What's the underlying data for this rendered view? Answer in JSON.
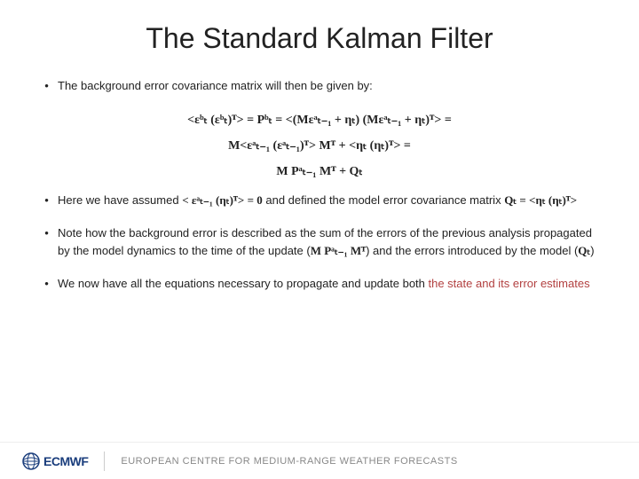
{
  "title": "The Standard Kalman Filter",
  "bullets": {
    "b1": "The background error covariance matrix will then be given by:",
    "b2_pre": "Here we have assumed ",
    "b2_post": " and defined the model error covariance matrix ",
    "b3_pre": "Note how the background error is described as the sum of the errors of the previous analysis propagated by the model dynamics to the time of the update (",
    "b3_mid": ") and the errors introduced by the model (",
    "b3_post": ")",
    "b4_pre": "We now have all the equations necessary to propagate and update both ",
    "b4_red": "the state and its error estimates"
  },
  "equations": {
    "eq1": "<εᵇₜ (εᵇₜ)ᵀ> = Pᵇₜ = <(Mεᵃₜ₋₁ + ηₜ) (Mεᵃₜ₋₁ + ηₜ)ᵀ> =",
    "eq2": "M<εᵃₜ₋₁ (εᵃₜ₋₁)ᵀ> Mᵀ + <ηₜ (ηₜ)ᵀ> =",
    "eq3": "M Pᵃₜ₋₁ Mᵀ + Qₜ",
    "assume_expr": "< εᵃₜ₋₁ (ηₜ)ᵀ> = 0",
    "q_def": "Qₜ = <ηₜ (ηₜ)ᵀ>",
    "mpam": "M Pᵃₜ₋₁ Mᵀ",
    "qt": "Qₜ"
  },
  "footer": {
    "org_abbrev": "ECMWF",
    "org_full": "EUROPEAN CENTRE FOR MEDIUM-RANGE WEATHER FORECASTS"
  }
}
